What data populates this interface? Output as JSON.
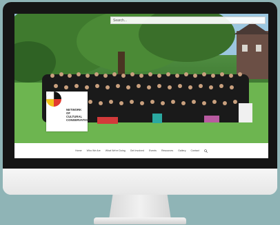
{
  "screen": {
    "search": {
      "text": "Search..."
    },
    "logo": {
      "line1": "NETWORK OF",
      "line2": "CULTURAL",
      "line3": "CONSERVATION"
    },
    "nav": {
      "items": [
        "Home",
        "Who We Are",
        "What We're Doing",
        "Get Involved",
        "Events",
        "Resources",
        "Gallery",
        "Contact"
      ]
    }
  },
  "icons": {
    "search": "search-icon",
    "logo": "medicine-wheel-icon"
  },
  "colors": {
    "background": "#8fb4b6",
    "bezel": "#151515",
    "chin": "#f3f3f3"
  }
}
